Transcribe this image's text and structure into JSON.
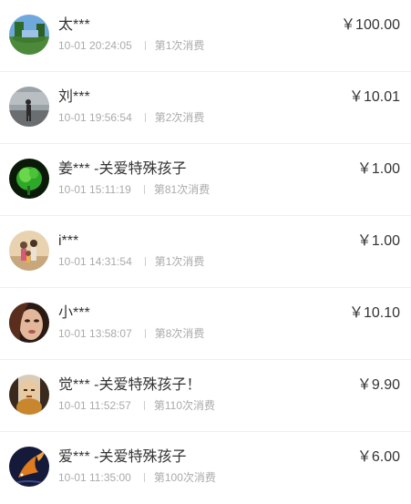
{
  "records": [
    {
      "name": "太***",
      "time": "10-01 20:24:05",
      "count": "第1次消费",
      "amount": "￥100.00",
      "avatar": "avatar-landscape-icon"
    },
    {
      "name": "刘***",
      "time": "10-01 19:56:54",
      "count": "第2次消费",
      "amount": "￥10.01",
      "avatar": "avatar-person-icon"
    },
    {
      "name": "姜*** -关爱特殊孩子",
      "time": "10-01 15:11:19",
      "count": "第81次消费",
      "amount": "￥1.00",
      "avatar": "avatar-green-plant-icon"
    },
    {
      "name": "i***",
      "time": "10-01 14:31:54",
      "count": "第1次消费",
      "amount": "￥1.00",
      "avatar": "avatar-family-icon"
    },
    {
      "name": "小***",
      "time": "10-01 13:58:07",
      "count": "第8次消费",
      "amount": "￥10.10",
      "avatar": "avatar-face-icon"
    },
    {
      "name": "觉*** -关爱特殊孩子！",
      "time": "10-01 11:52:57",
      "count": "第110次消费",
      "amount": "￥9.90",
      "avatar": "avatar-buddha-icon"
    },
    {
      "name": "爱*** -关爱特殊孩子",
      "time": "10-01 11:35:00",
      "count": "第100次消费",
      "amount": "￥6.00",
      "avatar": "avatar-koi-fish-icon"
    }
  ]
}
